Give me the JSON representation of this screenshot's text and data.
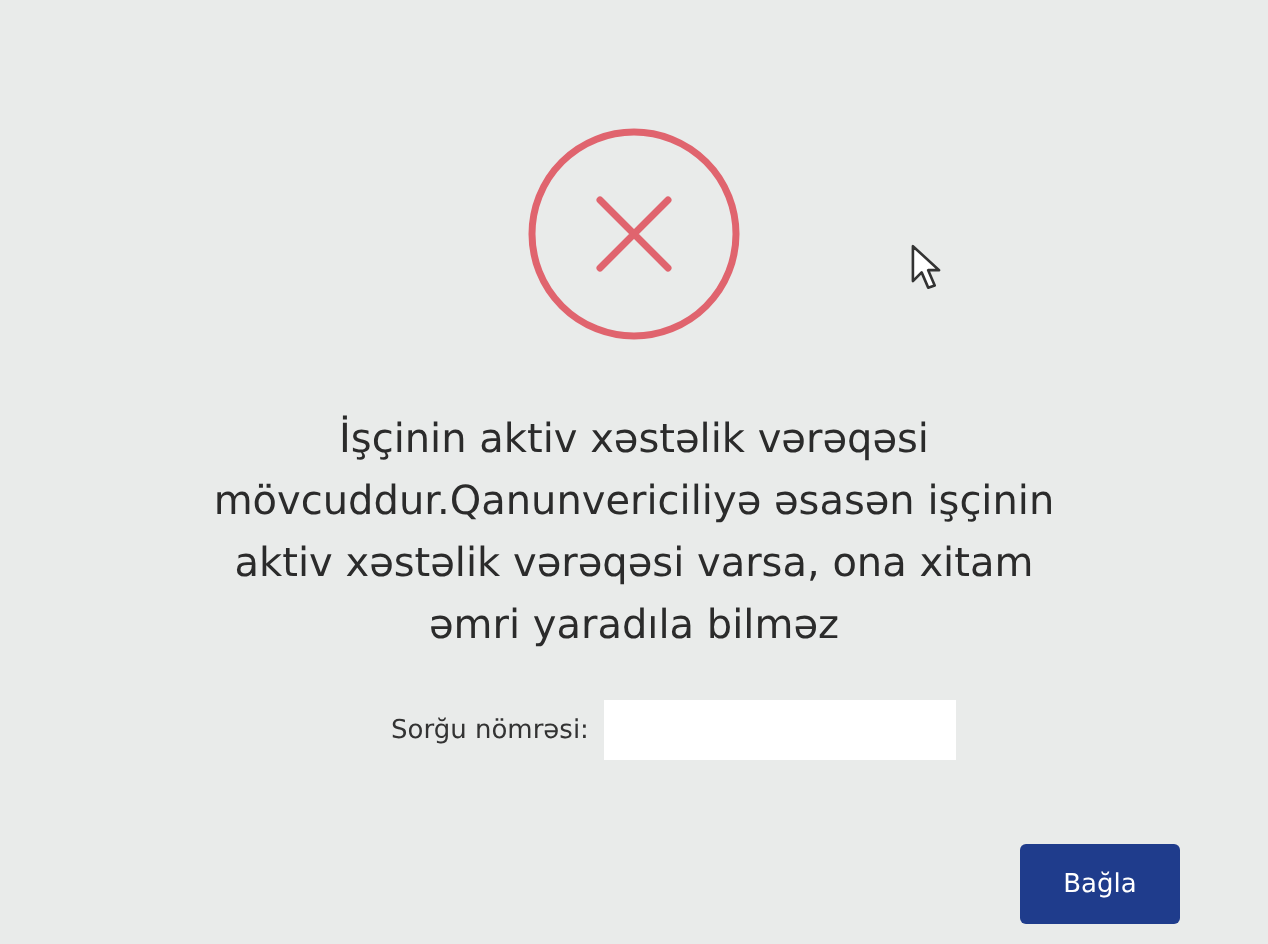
{
  "dialog": {
    "message": "İşçinin aktiv xəstəlik vərəqəsi mövcuddur.Qanunvericiliyə əsasən işçinin aktiv xəstəlik vərəqəsi varsa, ona xitam əmri yaradıla bilməz",
    "request_number": {
      "label": "Sorğu nömrəsi:"
    },
    "buttons": [
      {
        "label": "Bağla"
      }
    ]
  }
}
